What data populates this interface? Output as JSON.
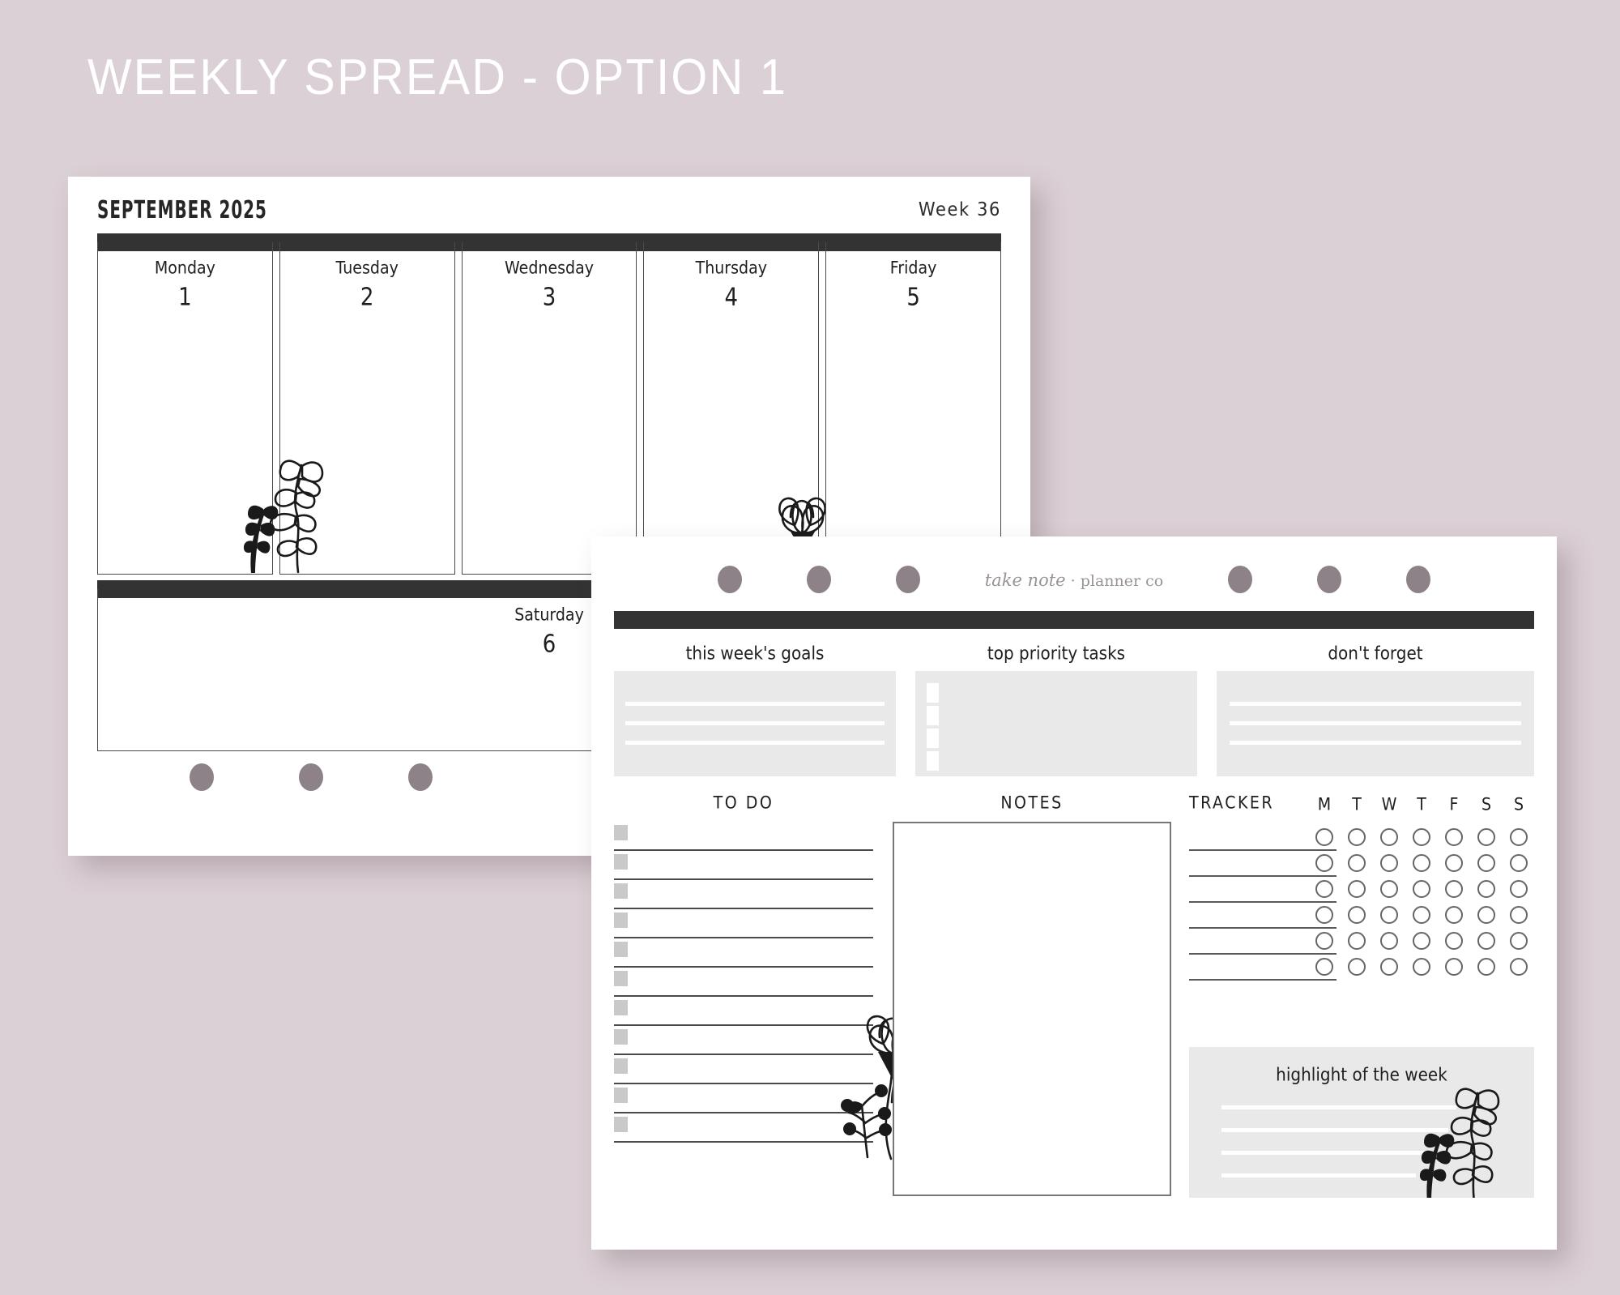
{
  "banner": {
    "title": "WEEKLY SPREAD - OPTION 1"
  },
  "colors": {
    "background": "#dbd0d5",
    "paper": "#ffffff",
    "ink": "#333333",
    "panel_gray": "#e9e9e9",
    "hole_gray": "#8e8289",
    "checkbox_gray": "#c9c9c9"
  },
  "page_one": {
    "month": "SEPTEMBER 2025",
    "week": "Week 36",
    "days": [
      {
        "name": "Monday",
        "number": "1"
      },
      {
        "name": "Tuesday",
        "number": "2"
      },
      {
        "name": "Wednesday",
        "number": "3"
      },
      {
        "name": "Thursday",
        "number": "4"
      },
      {
        "name": "Friday",
        "number": "5"
      }
    ],
    "saturday": {
      "name": "Saturday",
      "number": "6"
    },
    "brand_script": "take note",
    "brand_sep": " · ",
    "brand_plain": "planner co",
    "hole_count": 3
  },
  "page_two": {
    "brand_script": "take note",
    "brand_sep": " · ",
    "brand_plain": "planner co",
    "hole_count": 6,
    "sections": {
      "goals": {
        "title": "this week's goals",
        "line_count": 3
      },
      "priority": {
        "title": "top priority tasks",
        "checkbox_count": 4
      },
      "dont_forget": {
        "title": "don't forget",
        "line_count": 3
      },
      "todo": {
        "title": "TO DO",
        "row_count": 11
      },
      "notes": {
        "title": "NOTES"
      },
      "tracker": {
        "title": "TRACKER",
        "day_initials": [
          "M",
          "T",
          "W",
          "T",
          "F",
          "S",
          "S"
        ],
        "row_count": 6,
        "column_count": 7
      },
      "highlight": {
        "title": "highlight of the week",
        "line_count": 4
      }
    }
  }
}
